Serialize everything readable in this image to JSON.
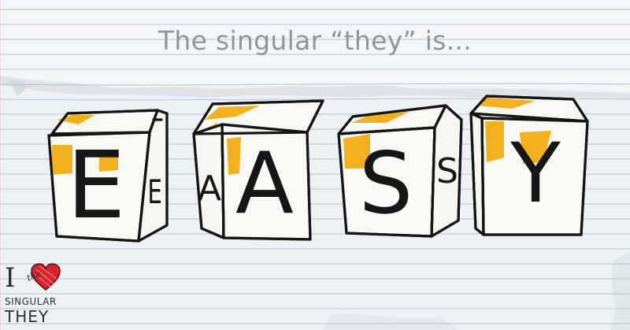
{
  "headline": "The singular “they” is...",
  "blocks": [
    {
      "front_letter": "E",
      "side_letter": "E"
    },
    {
      "front_letter": "A",
      "side_letter": "A"
    },
    {
      "front_letter": "S",
      "side_letter": "S"
    },
    {
      "front_letter": "Y",
      "side_letter": ""
    }
  ],
  "logo": {
    "i": "I",
    "the": "the",
    "singular": "SINGULAR",
    "they": "THEY"
  },
  "colors": {
    "paper": "#f1f3f5",
    "rule_line": "#9fb6d6",
    "highlight": "#f2b01e",
    "ink": "#161616",
    "heart": "#d8232e"
  }
}
